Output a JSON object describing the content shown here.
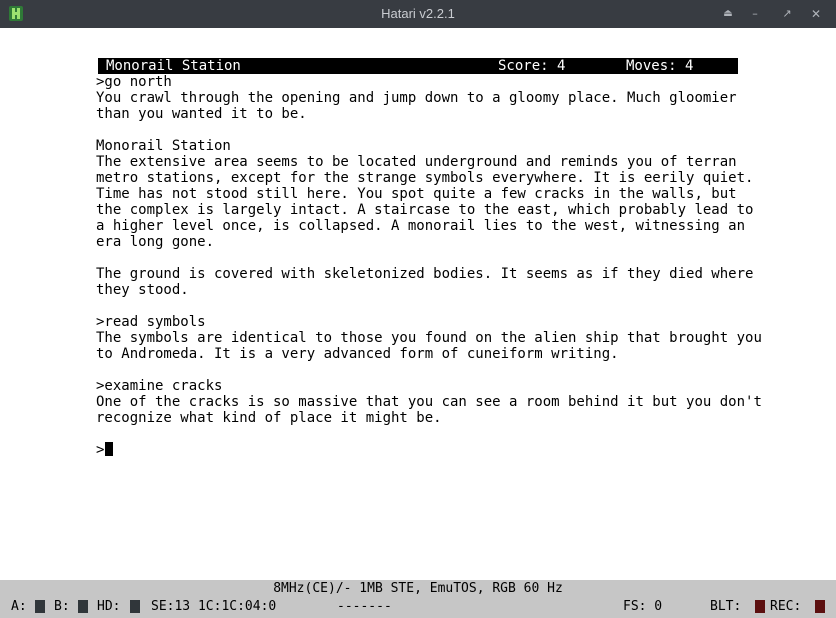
{
  "window": {
    "title": "Hatari v2.2.1"
  },
  "titlebar": {
    "eject": "⏏",
    "minimize": "–",
    "maximize": "↗",
    "close": "✕"
  },
  "game": {
    "status": {
      "location": "Monorail Station",
      "score": "Score: 4",
      "moves": "Moves: 4"
    },
    "transcript": [
      ">go north",
      "You crawl through the opening and jump down to a gloomy place. Much gloomier",
      "than you wanted it to be.",
      "",
      "Monorail Station",
      "The extensive area seems to be located underground and reminds you of terran",
      "metro stations, except for the strange symbols everywhere. It is eerily quiet.",
      "Time has not stood still here. You spot quite a few cracks in the walls, but",
      "the complex is largely intact. A staircase to the east, which probably lead to",
      "a higher level once, is collapsed. A monorail lies to the west, witnessing an",
      "era long gone.",
      "",
      "The ground is covered with skeletonized bodies. It seems as if they died where",
      "they stood.",
      "",
      ">read symbols",
      "The symbols are identical to those you found on the alien ship that brought you",
      "to Andromeda. It is a very advanced form of cuneiform writing.",
      "",
      ">examine cracks",
      "One of the cracks is so massive that you can see a room behind it but you don't",
      "recognize what kind of place it might be.",
      ""
    ],
    "prompt": ">"
  },
  "hatari_status": {
    "machine": "8MHz(CE)/- 1MB STE, EmuTOS, RGB 60 Hz",
    "drive_a": "A:",
    "drive_b": "B:",
    "drive_hd": "HD:",
    "floppy_pos": "SE:13 1C:1C:04:0",
    "message": "-------",
    "fs": "FS: 0",
    "blt": "BLT:",
    "rec": "REC:"
  }
}
